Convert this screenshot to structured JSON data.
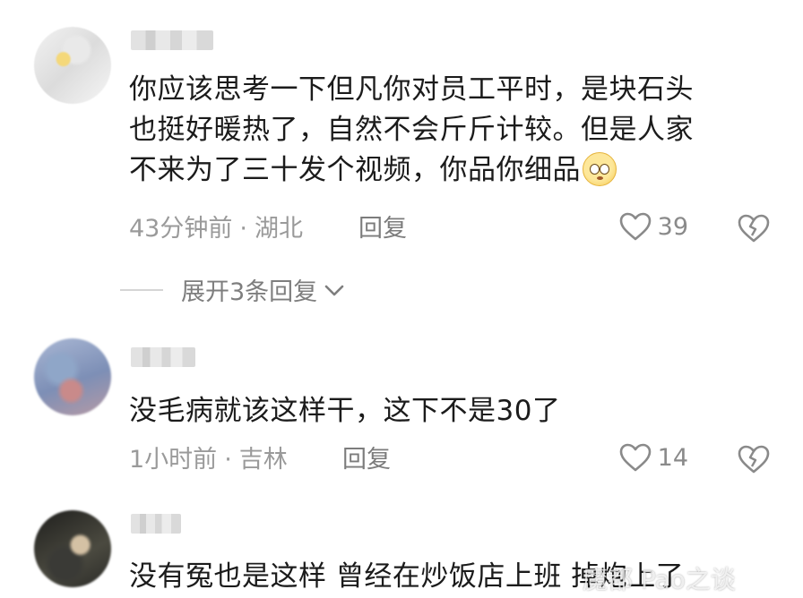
{
  "comments": [
    {
      "text_lines": [
        "你应该思考一下但凡你对员工平时，是块石头",
        "也挺好暖热了，自然不会斤斤计较。但是人家",
        "不来为了三十发个视频，你品你细品"
      ],
      "time": "43分钟前",
      "dot": "·",
      "location": "湖北",
      "reply_label": "回复",
      "likes": "39",
      "emoji": "pleading-face"
    },
    {
      "text_lines": [
        "没毛病就该这样干，这下不是30了"
      ],
      "time": "1小时前",
      "dot": "·",
      "location": "吉林",
      "reply_label": "回复",
      "likes": "14"
    },
    {
      "text_lines": [
        "没有冤也是这样  曾经在炒饭店上班  掉炮上了"
      ]
    }
  ],
  "expand_replies": {
    "label": "展开3条回复"
  },
  "watermark": "魔都 Pao之谈",
  "colors": {
    "text": "#1b1b1b",
    "meta": "#9a9a9a",
    "icon": "#8a8a8a"
  },
  "icons": [
    "heart-outline-icon",
    "broken-heart-icon",
    "chevron-down-icon"
  ]
}
